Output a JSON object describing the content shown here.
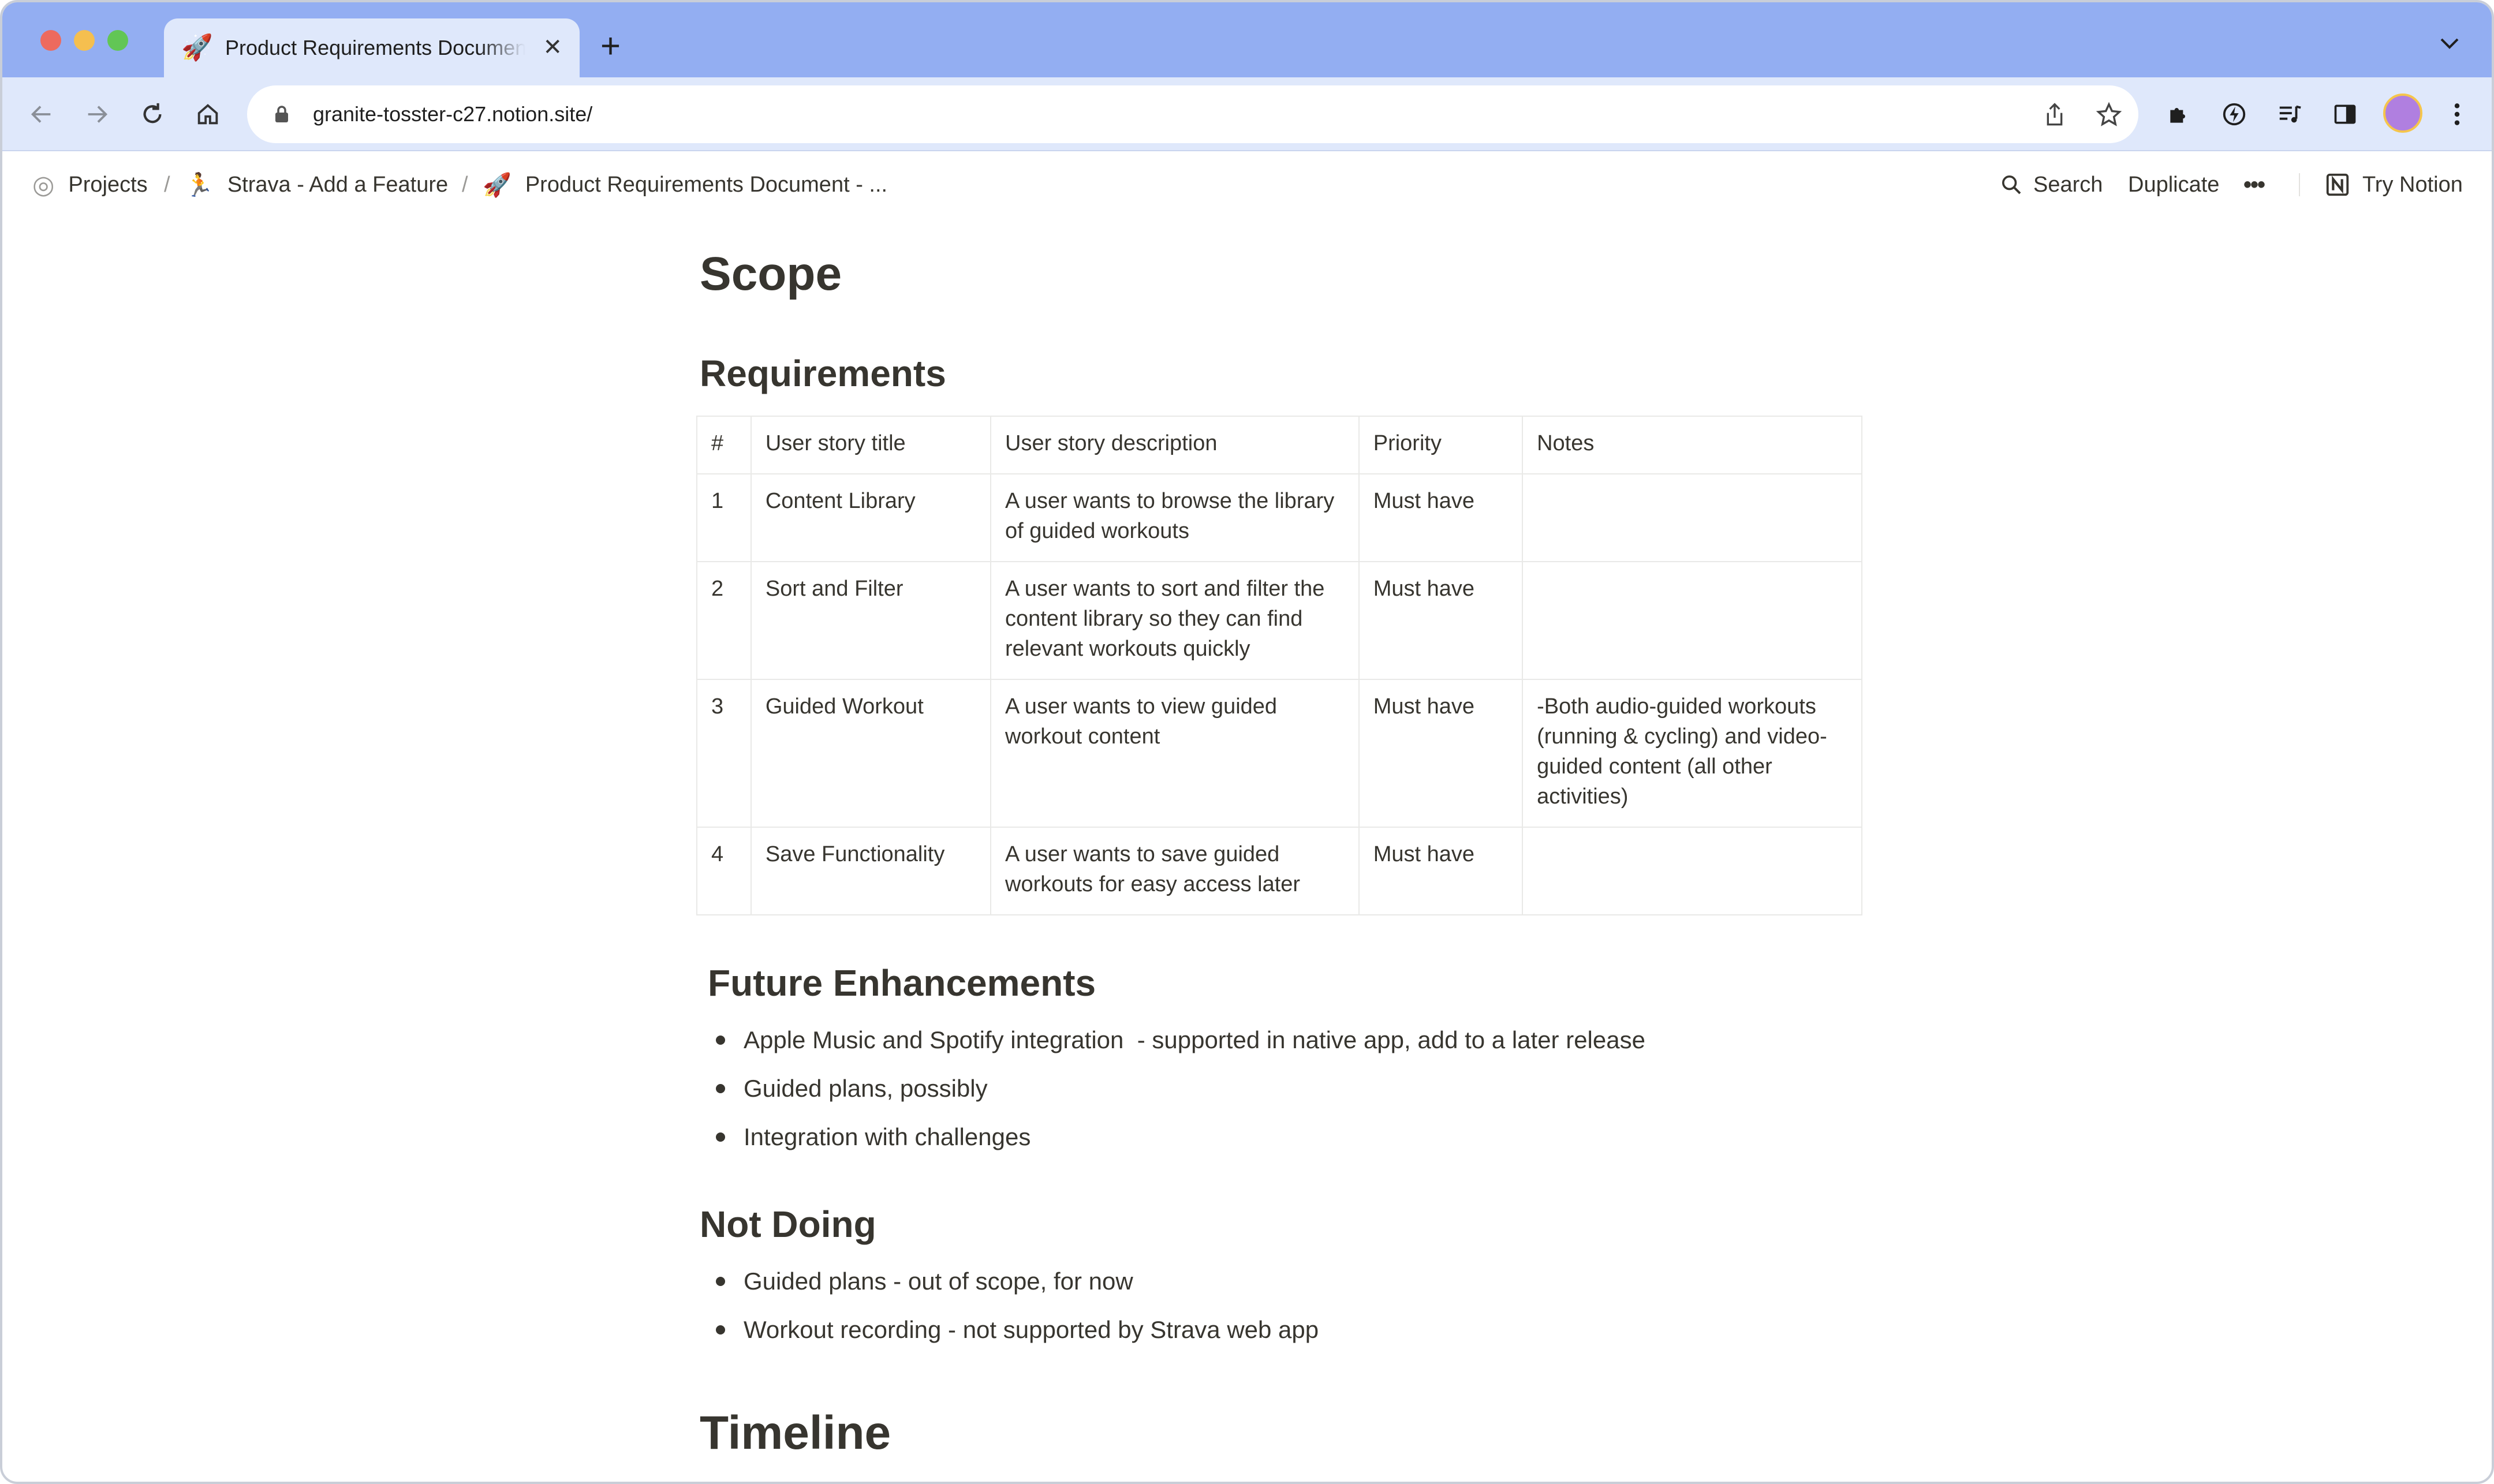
{
  "browser": {
    "tab_title": "Product Requirements Document - Strava",
    "tab_favicon": "🚀",
    "new_tab_label": "+",
    "close_label": "✕",
    "url": "granite-tosster-c27.notion.site/"
  },
  "breadcrumbs": [
    {
      "icon": "◎",
      "label": "Projects"
    },
    {
      "icon": "🏃",
      "label": "Strava - Add a Feature"
    },
    {
      "icon": "🚀",
      "label": "Product Requirements Document - ..."
    }
  ],
  "breadcrumb_separator": "/",
  "top_actions": {
    "search": "Search",
    "duplicate": "Duplicate",
    "more": "•••",
    "try_notion": "Try Notion"
  },
  "page": {
    "scope_heading": "Scope",
    "requirements_heading": "Requirements",
    "table": {
      "headers": [
        "#",
        "User story title",
        "User story description",
        "Priority",
        "Notes"
      ],
      "rows": [
        {
          "num": "1",
          "title": "Content Library",
          "desc": "A user wants to browse the library of guided workouts",
          "priority": "Must have",
          "notes": ""
        },
        {
          "num": "2",
          "title": "Sort and Filter",
          "desc": "A user wants to sort and filter the content library so they can find relevant workouts quickly",
          "priority": "Must have",
          "notes": ""
        },
        {
          "num": "3",
          "title": "Guided Workout",
          "desc": "A user wants to view guided workout content",
          "priority": "Must have",
          "notes": "-Both audio-guided workouts (running & cycling) and video-guided content (all other activities)"
        },
        {
          "num": "4",
          "title": "Save Functionality",
          "desc": "A user wants to save guided workouts for easy access later",
          "priority": "Must have",
          "notes": ""
        }
      ]
    },
    "future_heading": "Future Enhancements",
    "future_items": [
      "Apple Music and Spotify integration  - supported in native app, add to a later release",
      "Guided plans, possibly",
      "Integration with challenges"
    ],
    "notdoing_heading": "Not Doing",
    "notdoing_items": [
      "Guided plans - out of scope, for now",
      "Workout recording - not supported by Strava web app"
    ],
    "timeline_heading": "Timeline"
  }
}
